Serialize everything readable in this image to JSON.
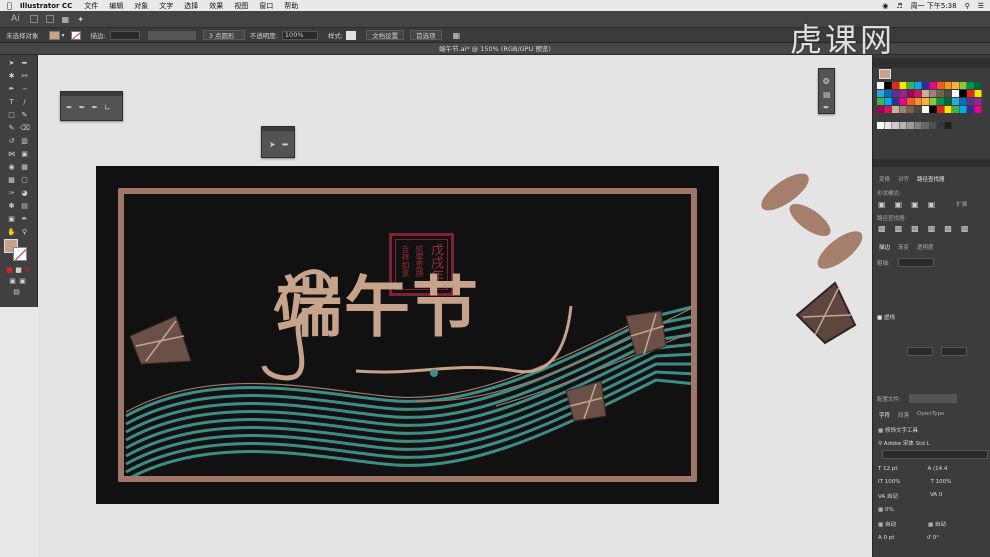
{
  "mac_menubar": {
    "app_name": "Illustrator CC",
    "menus": [
      "文件",
      "编辑",
      "对象",
      "文字",
      "选择",
      "效果",
      "视图",
      "窗口",
      "帮助"
    ],
    "clock": "周一 下午5:38"
  },
  "appbar": {
    "logo": "Ai"
  },
  "control_bar": {
    "selection_label": "未选择对象",
    "stroke_label": "描边:",
    "brush_label": "3 点圆形",
    "opacity_label": "不透明度:",
    "opacity_value": "100%",
    "style_label": "样式:",
    "doc_setup_button": "文档设置",
    "preferences_button": "首选项"
  },
  "document": {
    "tab_title": "端午节.ai* @ 150% (RGB/GPU 预览)"
  },
  "artwork": {
    "title": "端午节",
    "seal_right": "戊戌年",
    "seal_mid": "贰零壹捌",
    "seal_left": "吉祥如意"
  },
  "right_panel": {
    "tabs_top": [
      "变换",
      "对齐",
      "路径查找器"
    ],
    "shape_modes_label": "形状模式:",
    "expand_button": "扩展",
    "pathfinder_label": "路径查找器:",
    "tabs_mid": [
      "描边",
      "渐变",
      "透明度"
    ],
    "weight_label": "粗细:",
    "section_dashed": "虚线",
    "profile_label": "配置文件:",
    "tabs_char": [
      "字符",
      "段落",
      "OpenType"
    ],
    "touch_type": "修饰文字工具",
    "font_name": "Adobe 宋体 Std L",
    "font_size": "12 pt",
    "leading": "(14.4",
    "h_scale": "100%",
    "v_scale": "100%",
    "kerning": "自动",
    "tracking": "0",
    "tsume": "0%",
    "auto_a": "自动",
    "auto_b": "自动",
    "baseline": "0 pt",
    "rotation": "0°"
  },
  "colors": {
    "accent": "#a0786a",
    "title": "#c6a48c",
    "teal": "#3f8c87",
    "seal": "#7e2231"
  }
}
